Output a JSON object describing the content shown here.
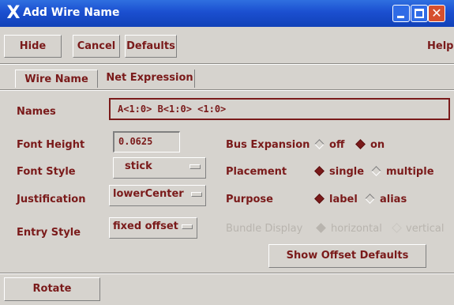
{
  "window": {
    "title": "Add Wire Name"
  },
  "toolbar": {
    "hide": "Hide",
    "cancel": "Cancel",
    "defaults": "Defaults",
    "help": "Help"
  },
  "tabs": [
    {
      "label": "Wire Name",
      "active": true
    },
    {
      "label": "Net Expression",
      "active": false
    }
  ],
  "form": {
    "names": {
      "label": "Names",
      "value": "A<1:0> B<1:0> <1:0>"
    },
    "font_height": {
      "label": "Font Height",
      "value": "0.0625"
    },
    "font_style": {
      "label": "Font Style",
      "value": "stick"
    },
    "justification": {
      "label": "Justification",
      "value": "lowerCenter"
    },
    "entry_style": {
      "label": "Entry Style",
      "value": "fixed offset"
    },
    "bus_expansion": {
      "label": "Bus Expansion",
      "options": [
        "off",
        "on"
      ],
      "selected": "on"
    },
    "placement": {
      "label": "Placement",
      "options": [
        "single",
        "multiple"
      ],
      "selected": "single"
    },
    "purpose": {
      "label": "Purpose",
      "options": [
        "label",
        "alias"
      ],
      "selected": "label"
    },
    "bundle_display": {
      "label": "Bundle Display",
      "options": [
        "horizontal",
        "vertical"
      ],
      "selected": "horizontal",
      "enabled": false
    },
    "show_offset_defaults": "Show Offset Defaults"
  },
  "footer": {
    "rotate": "Rotate"
  },
  "colors": {
    "title_bar": "#1b4fd0",
    "panel": "#d6d3ce",
    "text": "#7a1a1a",
    "disabled_text": "#b8b4ae"
  },
  "icons": [
    "x-window-icon",
    "minimize-icon",
    "maximize-icon",
    "close-icon"
  ]
}
